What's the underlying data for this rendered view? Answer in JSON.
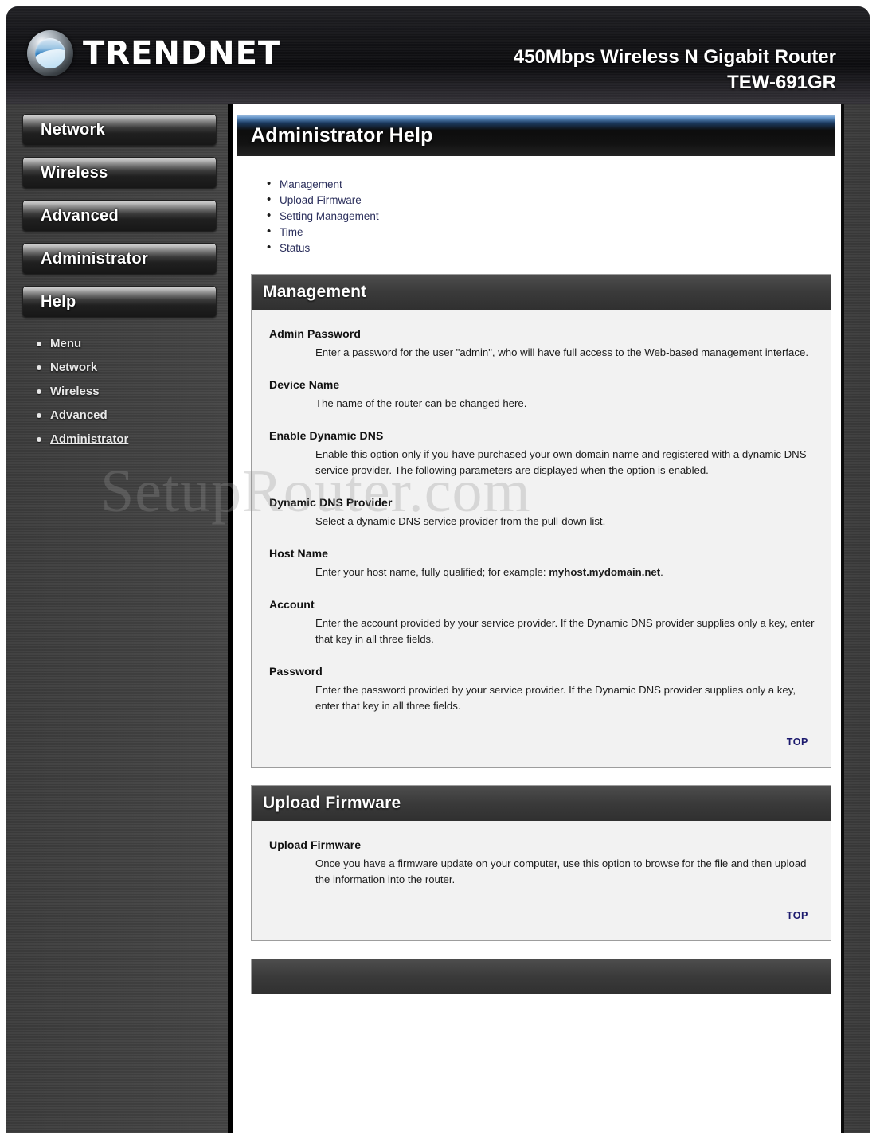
{
  "header": {
    "brand": "TRENDNET",
    "product_line1": "450Mbps Wireless N Gigabit Router",
    "product_line2": "TEW-691GR"
  },
  "sidebar": {
    "buttons": [
      {
        "label": "Network"
      },
      {
        "label": "Wireless"
      },
      {
        "label": "Advanced"
      },
      {
        "label": "Administrator"
      },
      {
        "label": "Help"
      }
    ],
    "subitems": [
      {
        "label": "Menu",
        "active": false
      },
      {
        "label": "Network",
        "active": false
      },
      {
        "label": "Wireless",
        "active": false
      },
      {
        "label": "Advanced",
        "active": false
      },
      {
        "label": "Administrator",
        "active": true
      }
    ]
  },
  "page": {
    "title": "Administrator Help",
    "watermark": "SetupRouter.com",
    "top_link_label": "TOP"
  },
  "toc": [
    {
      "label": "Management"
    },
    {
      "label": "Upload Firmware"
    },
    {
      "label": "Setting Management"
    },
    {
      "label": "Time"
    },
    {
      "label": "Status"
    }
  ],
  "sections": [
    {
      "heading": "Management",
      "items": [
        {
          "title": "Admin Password",
          "desc": "Enter a password for the user \"admin\", who will have full access to the Web-based management interface."
        },
        {
          "title": "Device Name",
          "desc": "The name of the router can be changed here."
        },
        {
          "title": "Enable Dynamic DNS",
          "desc": "Enable this option only if you have purchased your own domain name and registered with a dynamic DNS service provider. The following parameters are displayed when the option is enabled."
        },
        {
          "title": "Dynamic DNS Provider",
          "desc": "Select a dynamic DNS service provider from the pull-down list."
        },
        {
          "title": "Host Name",
          "desc_pre": "Enter your host name, fully qualified; for example: ",
          "desc_bold": "myhost.mydomain.net",
          "desc_post": "."
        },
        {
          "title": "Account",
          "desc": "Enter the account provided by your service provider. If the Dynamic DNS provider supplies only a key, enter that key in all three fields."
        },
        {
          "title": "Password",
          "desc": "Enter the password provided by your service provider. If the Dynamic DNS provider supplies only a key, enter that key in all three fields."
        }
      ]
    },
    {
      "heading": "Upload Firmware",
      "items": [
        {
          "title": "Upload Firmware",
          "desc": "Once you have a firmware update on your computer, use this option to browse for the file and then upload the information into the router."
        }
      ]
    }
  ]
}
